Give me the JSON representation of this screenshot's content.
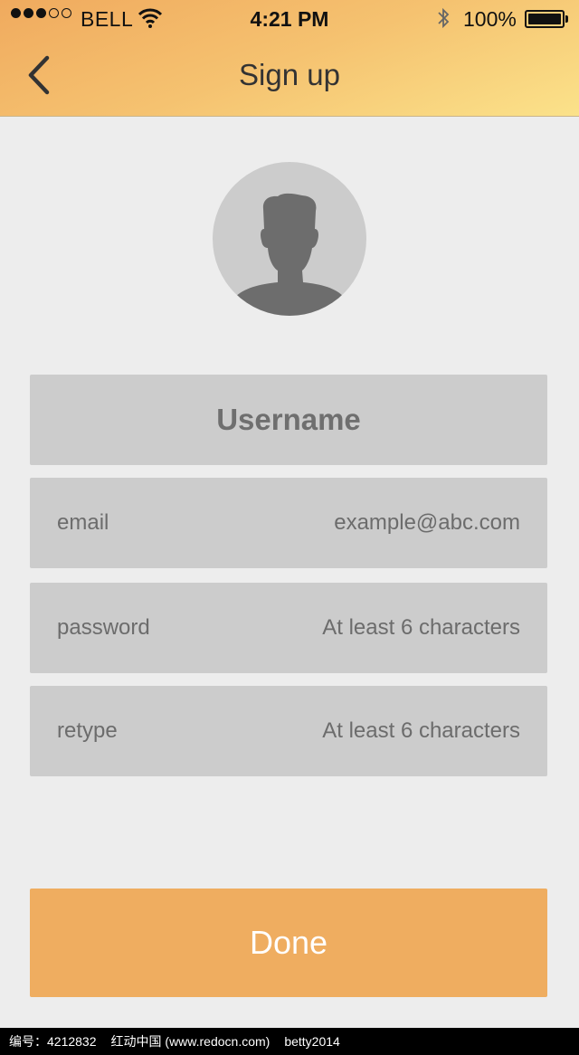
{
  "status_bar": {
    "signal_dots": [
      true,
      true,
      true,
      false,
      false
    ],
    "carrier": "BELL",
    "time": "4:21 PM",
    "battery_percent": "100%",
    "battery_level": 1.0
  },
  "nav": {
    "title": "Sign up",
    "back_icon": "chevron-left-icon"
  },
  "avatar": {
    "icon": "user-silhouette-icon"
  },
  "form": {
    "username_label": "Username",
    "email": {
      "label": "email",
      "placeholder": "example@abc.com"
    },
    "password": {
      "label": "password",
      "placeholder": "At least 6 characters"
    },
    "retype": {
      "label": "retype",
      "placeholder": "At least 6 characters"
    }
  },
  "done_label": "Done",
  "footer": {
    "id_text": "编号：4212832",
    "site_text": "红动中国 (www.redocn.com)",
    "author_text": "betty2014"
  },
  "colors": {
    "header_gradient_start": "#f0aa5e",
    "header_gradient_end": "#fbe28a",
    "background": "#ededed",
    "field_bg": "#cccccc",
    "accent": "#efad60"
  }
}
